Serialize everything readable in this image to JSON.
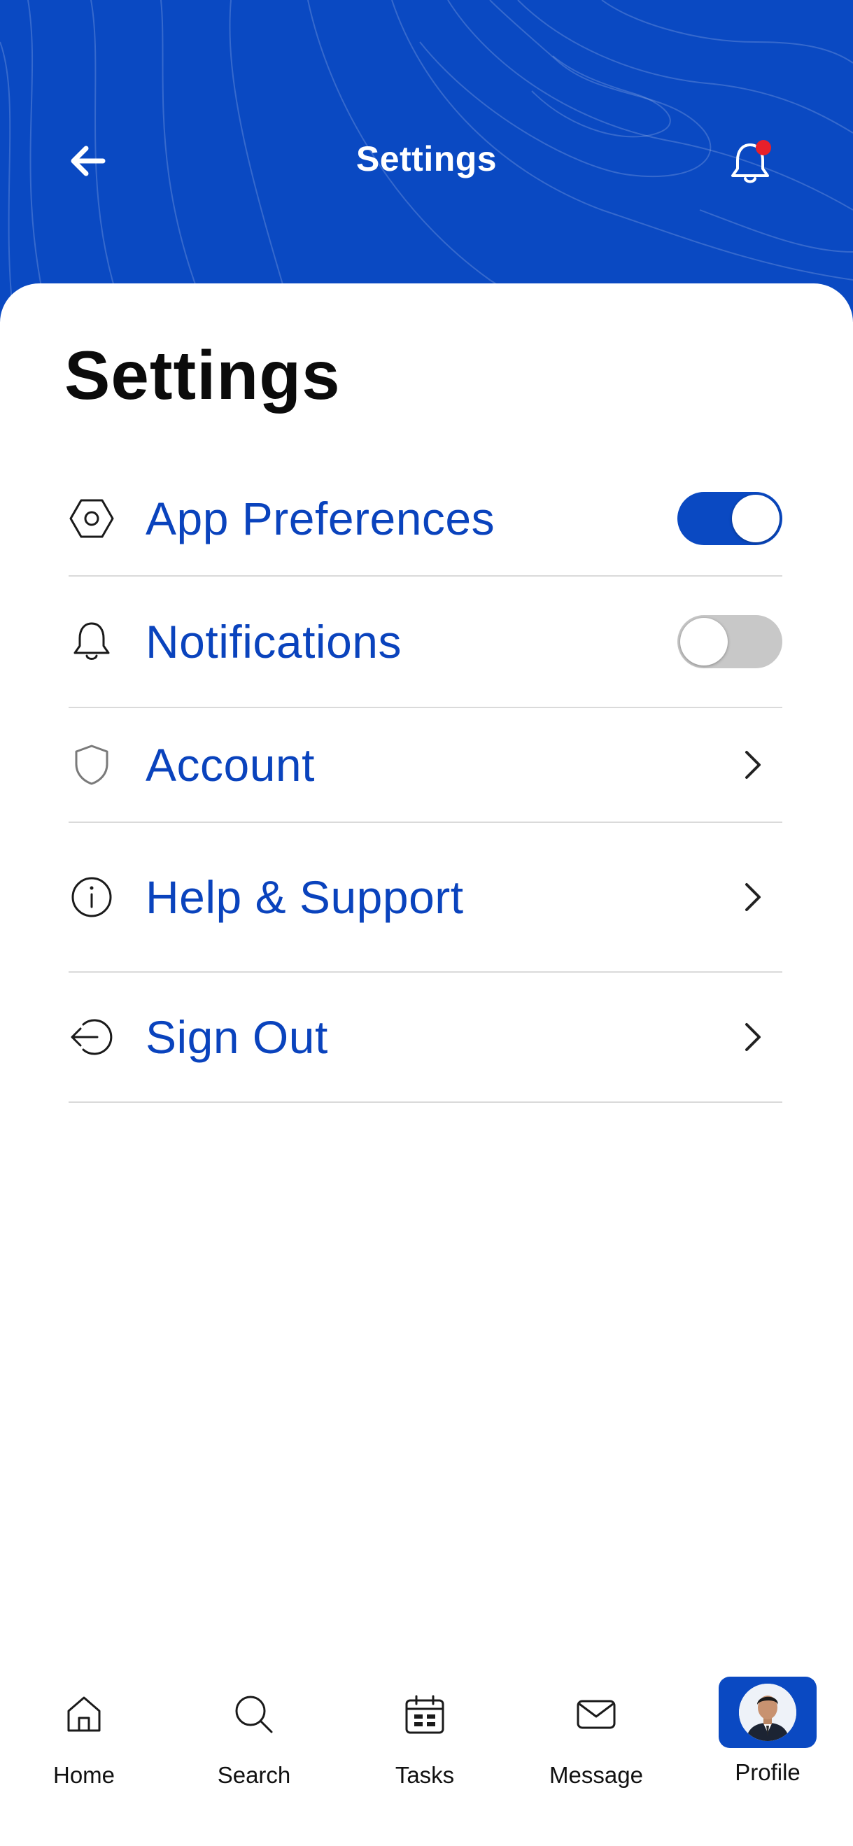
{
  "colors": {
    "brand_blue": "#0a49c2",
    "label_blue": "#0a43bd",
    "toggle_off": "#c8c8c8",
    "notification_dot": "#e8202a",
    "divider": "#dadada"
  },
  "header": {
    "title": "Settings",
    "back_icon": "arrow-left-icon",
    "bell_icon": "bell-icon",
    "has_notification": true
  },
  "page": {
    "title": "Settings"
  },
  "settings": {
    "items": [
      {
        "label": "App Preferences",
        "icon": "hexagon-gear-icon",
        "control": "toggle",
        "enabled": true
      },
      {
        "label": "Notifications",
        "icon": "bell-icon",
        "control": "toggle",
        "enabled": false
      },
      {
        "label": "Account",
        "icon": "shield-icon",
        "control": "chevron"
      },
      {
        "label": "Help & Support",
        "icon": "info-icon",
        "control": "chevron"
      },
      {
        "label": "Sign Out",
        "icon": "logout-icon",
        "control": "chevron"
      }
    ]
  },
  "bottom_nav": {
    "items": [
      {
        "label": "Home",
        "icon": "home-icon"
      },
      {
        "label": "Search",
        "icon": "search-icon"
      },
      {
        "label": "Tasks",
        "icon": "calendar-icon"
      },
      {
        "label": "Message",
        "icon": "envelope-icon"
      },
      {
        "label": "Profile",
        "icon": "avatar",
        "active": true
      }
    ]
  }
}
